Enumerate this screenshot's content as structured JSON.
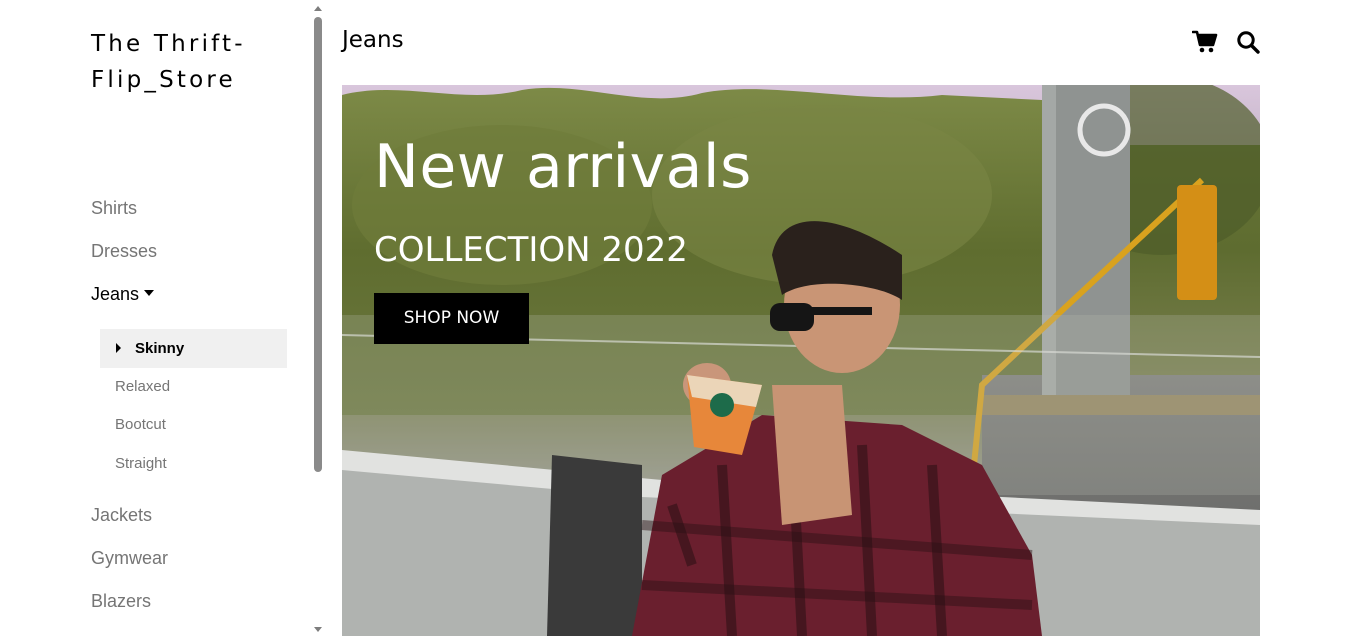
{
  "brand": {
    "name": "The Thrift-Flip_Store"
  },
  "sidebar": {
    "items": [
      {
        "label": "Shirts"
      },
      {
        "label": "Dresses"
      },
      {
        "label": "Jeans"
      },
      {
        "label": "Jackets"
      },
      {
        "label": "Gymwear"
      },
      {
        "label": "Blazers"
      }
    ],
    "jeans_sub": [
      {
        "label": "Skinny"
      },
      {
        "label": "Relaxed"
      },
      {
        "label": "Bootcut"
      },
      {
        "label": "Straight"
      }
    ]
  },
  "header": {
    "title": "Jeans",
    "icons": [
      "shopping-cart-icon",
      "search-icon"
    ]
  },
  "hero": {
    "headline": "New arrivals",
    "subheadline": "COLLECTION 2022",
    "button_label": "SHOP NOW"
  },
  "colors": {
    "nav_text": "#757575",
    "active_text": "#000000",
    "selected_bg": "#f0f0f0",
    "button_bg": "#000000"
  }
}
